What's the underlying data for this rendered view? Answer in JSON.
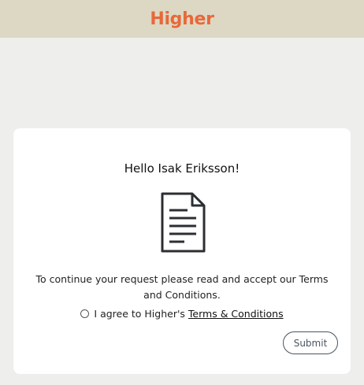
{
  "header": {
    "logo_text": "Higher",
    "brand_color": "#e8683a",
    "background_color": "#dcd8c4"
  },
  "card": {
    "greeting": "Hello Isak Eriksson!",
    "icon": "document-icon",
    "message": "To continue your request please read and accept our Terms and Conditions.",
    "agree_label": "I agree to Higher's",
    "terms_link": "Terms & Conditions",
    "submit_label": "Submit"
  }
}
